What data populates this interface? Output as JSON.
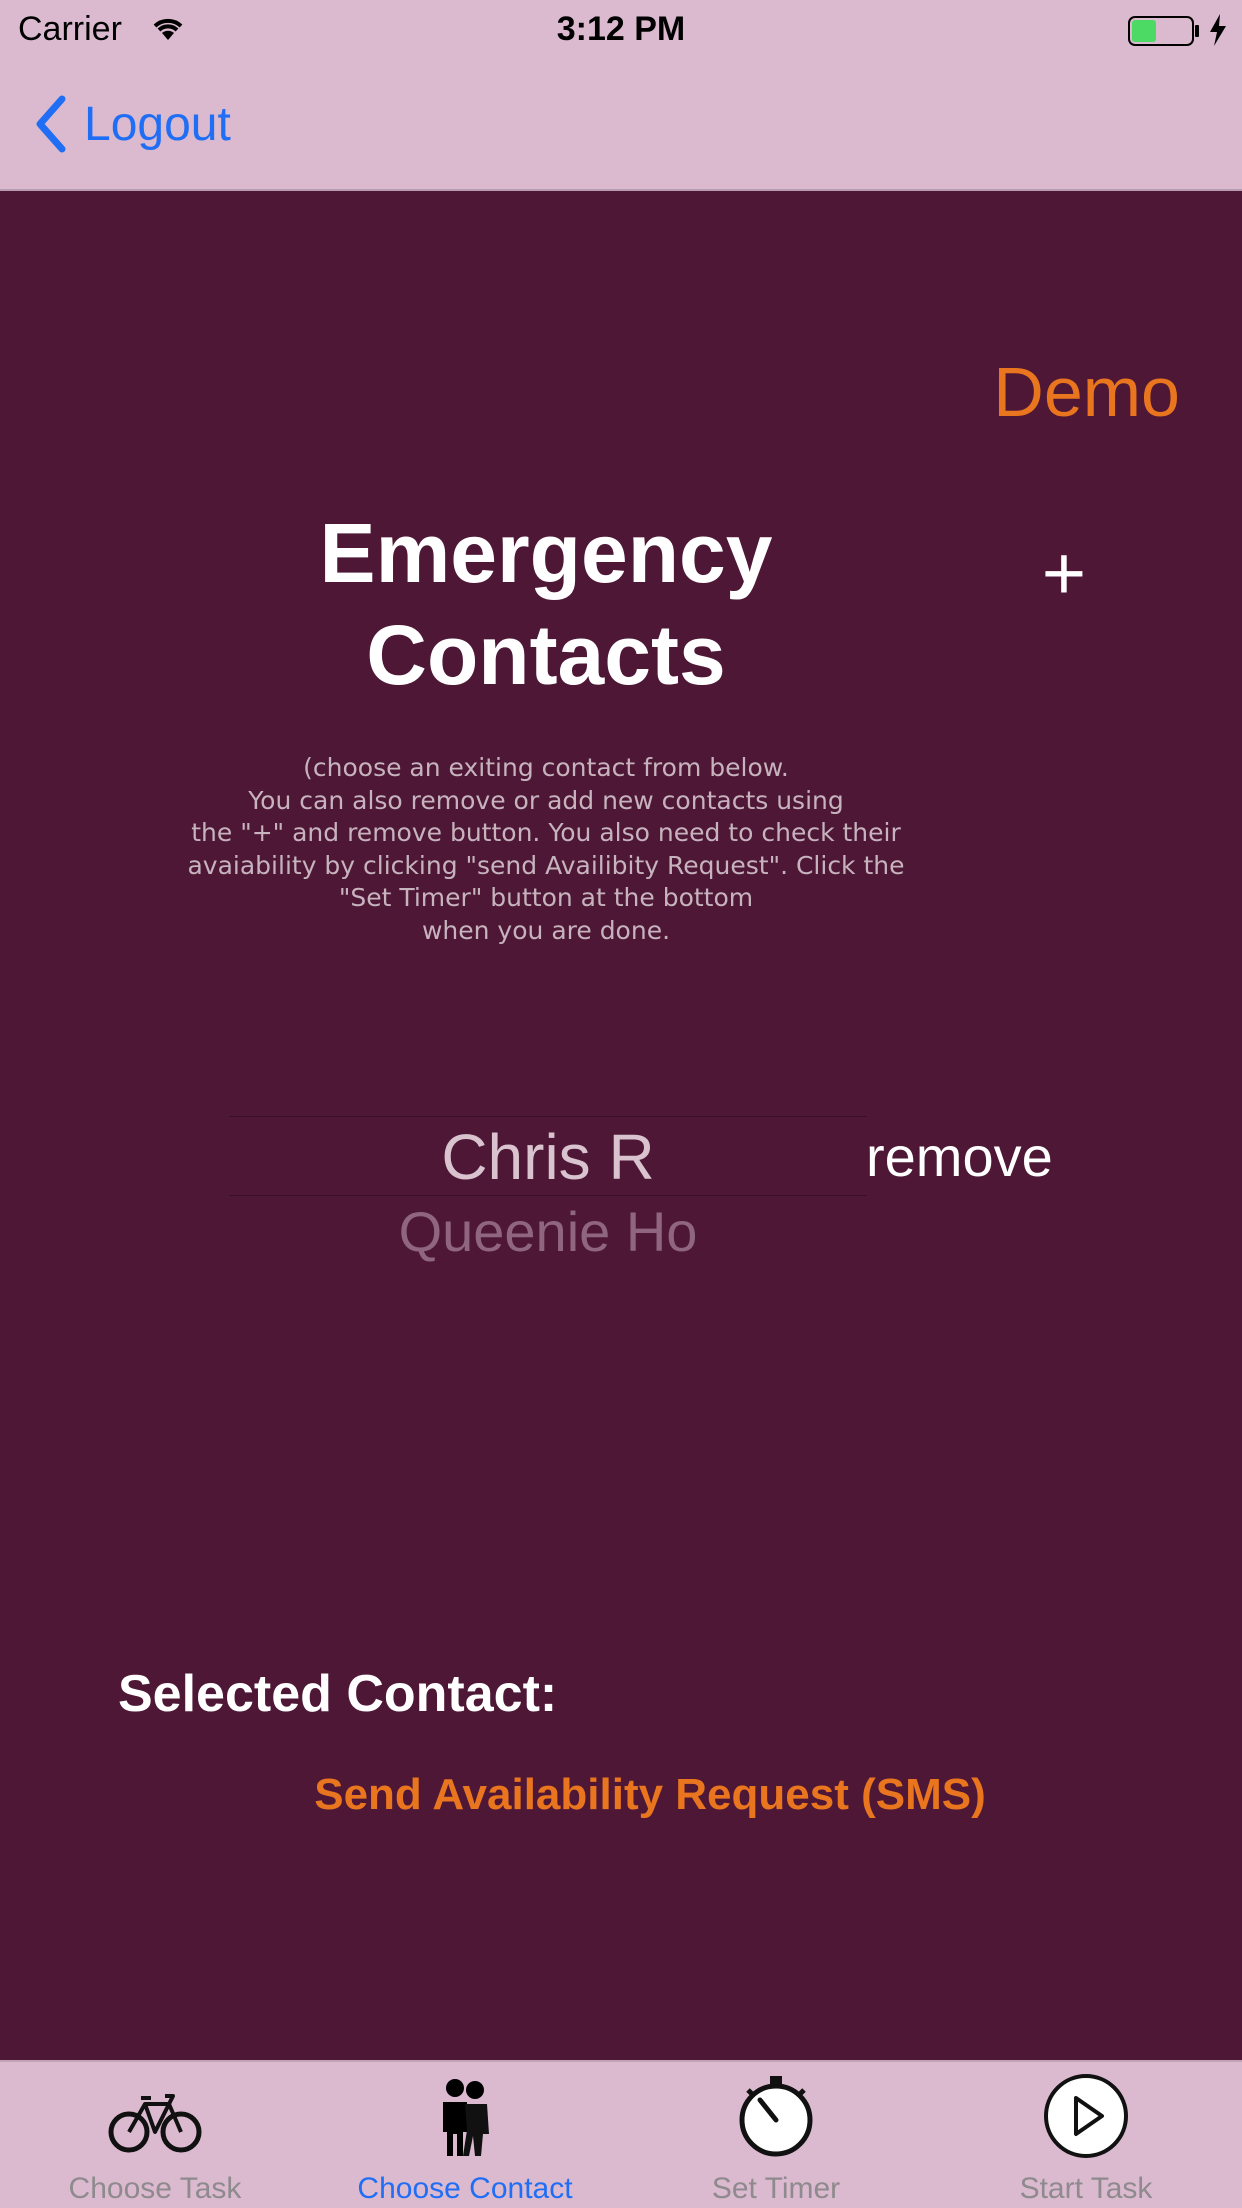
{
  "status_bar": {
    "carrier": "Carrier",
    "time": "3:12 PM",
    "battery_color": "#4cd964"
  },
  "nav": {
    "back_label": "Logout",
    "accent_color": "#1f6ef5"
  },
  "header": {
    "demo_label": "Demo",
    "title_line1": "Emergency",
    "title_line2": "Contacts",
    "add_label": "+"
  },
  "instructions": "(choose an exiting contact from below.\nYou can also remove or add new contacts using\nthe \"+\" and remove button. You also need to check their\navaiability by clicking \"send Availibity Request\". Click the\n\"Set Timer\" button at the bottom\nwhen you are done.",
  "contacts_picker": {
    "selected": "Chris R",
    "next": "Queenie Ho",
    "remove_label": "remove"
  },
  "selected_contact": {
    "label": "Selected Contact:"
  },
  "sms_button": {
    "label": "Send Availability Request (SMS)",
    "color": "#e9751f"
  },
  "tabs": [
    {
      "label": "Choose Task",
      "icon": "bicycle-icon",
      "active": false
    },
    {
      "label": "Choose Contact",
      "icon": "people-icon",
      "active": true
    },
    {
      "label": "Set Timer",
      "icon": "stopwatch-icon",
      "active": false
    },
    {
      "label": "Start Task",
      "icon": "play-icon",
      "active": false
    }
  ],
  "colors": {
    "background": "#4e1736",
    "bars": "#dbbad0"
  }
}
